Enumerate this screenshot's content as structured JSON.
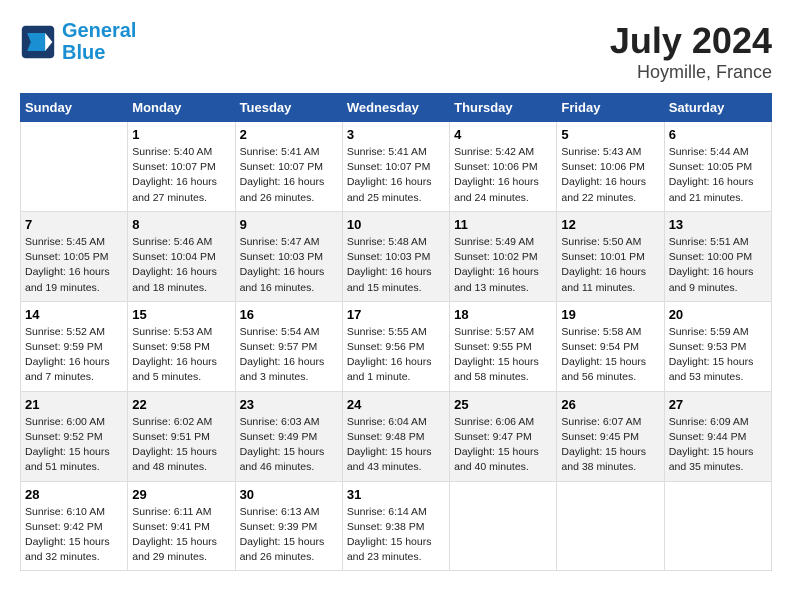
{
  "logo": {
    "text_general": "General",
    "text_blue": "Blue"
  },
  "title": "July 2024",
  "subtitle": "Hoymille, France",
  "days_of_week": [
    "Sunday",
    "Monday",
    "Tuesday",
    "Wednesday",
    "Thursday",
    "Friday",
    "Saturday"
  ],
  "weeks": [
    [
      {
        "day": "",
        "info": ""
      },
      {
        "day": "1",
        "info": "Sunrise: 5:40 AM\nSunset: 10:07 PM\nDaylight: 16 hours\nand 27 minutes."
      },
      {
        "day": "2",
        "info": "Sunrise: 5:41 AM\nSunset: 10:07 PM\nDaylight: 16 hours\nand 26 minutes."
      },
      {
        "day": "3",
        "info": "Sunrise: 5:41 AM\nSunset: 10:07 PM\nDaylight: 16 hours\nand 25 minutes."
      },
      {
        "day": "4",
        "info": "Sunrise: 5:42 AM\nSunset: 10:06 PM\nDaylight: 16 hours\nand 24 minutes."
      },
      {
        "day": "5",
        "info": "Sunrise: 5:43 AM\nSunset: 10:06 PM\nDaylight: 16 hours\nand 22 minutes."
      },
      {
        "day": "6",
        "info": "Sunrise: 5:44 AM\nSunset: 10:05 PM\nDaylight: 16 hours\nand 21 minutes."
      }
    ],
    [
      {
        "day": "7",
        "info": "Sunrise: 5:45 AM\nSunset: 10:05 PM\nDaylight: 16 hours\nand 19 minutes."
      },
      {
        "day": "8",
        "info": "Sunrise: 5:46 AM\nSunset: 10:04 PM\nDaylight: 16 hours\nand 18 minutes."
      },
      {
        "day": "9",
        "info": "Sunrise: 5:47 AM\nSunset: 10:03 PM\nDaylight: 16 hours\nand 16 minutes."
      },
      {
        "day": "10",
        "info": "Sunrise: 5:48 AM\nSunset: 10:03 PM\nDaylight: 16 hours\nand 15 minutes."
      },
      {
        "day": "11",
        "info": "Sunrise: 5:49 AM\nSunset: 10:02 PM\nDaylight: 16 hours\nand 13 minutes."
      },
      {
        "day": "12",
        "info": "Sunrise: 5:50 AM\nSunset: 10:01 PM\nDaylight: 16 hours\nand 11 minutes."
      },
      {
        "day": "13",
        "info": "Sunrise: 5:51 AM\nSunset: 10:00 PM\nDaylight: 16 hours\nand 9 minutes."
      }
    ],
    [
      {
        "day": "14",
        "info": "Sunrise: 5:52 AM\nSunset: 9:59 PM\nDaylight: 16 hours\nand 7 minutes."
      },
      {
        "day": "15",
        "info": "Sunrise: 5:53 AM\nSunset: 9:58 PM\nDaylight: 16 hours\nand 5 minutes."
      },
      {
        "day": "16",
        "info": "Sunrise: 5:54 AM\nSunset: 9:57 PM\nDaylight: 16 hours\nand 3 minutes."
      },
      {
        "day": "17",
        "info": "Sunrise: 5:55 AM\nSunset: 9:56 PM\nDaylight: 16 hours\nand 1 minute."
      },
      {
        "day": "18",
        "info": "Sunrise: 5:57 AM\nSunset: 9:55 PM\nDaylight: 15 hours\nand 58 minutes."
      },
      {
        "day": "19",
        "info": "Sunrise: 5:58 AM\nSunset: 9:54 PM\nDaylight: 15 hours\nand 56 minutes."
      },
      {
        "day": "20",
        "info": "Sunrise: 5:59 AM\nSunset: 9:53 PM\nDaylight: 15 hours\nand 53 minutes."
      }
    ],
    [
      {
        "day": "21",
        "info": "Sunrise: 6:00 AM\nSunset: 9:52 PM\nDaylight: 15 hours\nand 51 minutes."
      },
      {
        "day": "22",
        "info": "Sunrise: 6:02 AM\nSunset: 9:51 PM\nDaylight: 15 hours\nand 48 minutes."
      },
      {
        "day": "23",
        "info": "Sunrise: 6:03 AM\nSunset: 9:49 PM\nDaylight: 15 hours\nand 46 minutes."
      },
      {
        "day": "24",
        "info": "Sunrise: 6:04 AM\nSunset: 9:48 PM\nDaylight: 15 hours\nand 43 minutes."
      },
      {
        "day": "25",
        "info": "Sunrise: 6:06 AM\nSunset: 9:47 PM\nDaylight: 15 hours\nand 40 minutes."
      },
      {
        "day": "26",
        "info": "Sunrise: 6:07 AM\nSunset: 9:45 PM\nDaylight: 15 hours\nand 38 minutes."
      },
      {
        "day": "27",
        "info": "Sunrise: 6:09 AM\nSunset: 9:44 PM\nDaylight: 15 hours\nand 35 minutes."
      }
    ],
    [
      {
        "day": "28",
        "info": "Sunrise: 6:10 AM\nSunset: 9:42 PM\nDaylight: 15 hours\nand 32 minutes."
      },
      {
        "day": "29",
        "info": "Sunrise: 6:11 AM\nSunset: 9:41 PM\nDaylight: 15 hours\nand 29 minutes."
      },
      {
        "day": "30",
        "info": "Sunrise: 6:13 AM\nSunset: 9:39 PM\nDaylight: 15 hours\nand 26 minutes."
      },
      {
        "day": "31",
        "info": "Sunrise: 6:14 AM\nSunset: 9:38 PM\nDaylight: 15 hours\nand 23 minutes."
      },
      {
        "day": "",
        "info": ""
      },
      {
        "day": "",
        "info": ""
      },
      {
        "day": "",
        "info": ""
      }
    ]
  ]
}
